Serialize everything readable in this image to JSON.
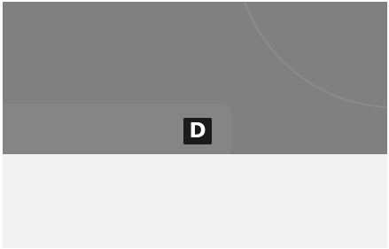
{
  "key_badge": {
    "label": "D"
  },
  "colors": {
    "overlay": "#808080",
    "card": "#858585",
    "badge_bg": "#1b1b1b",
    "badge_fg": "#ffffff",
    "bottom_panel": "#f2f2f2"
  }
}
